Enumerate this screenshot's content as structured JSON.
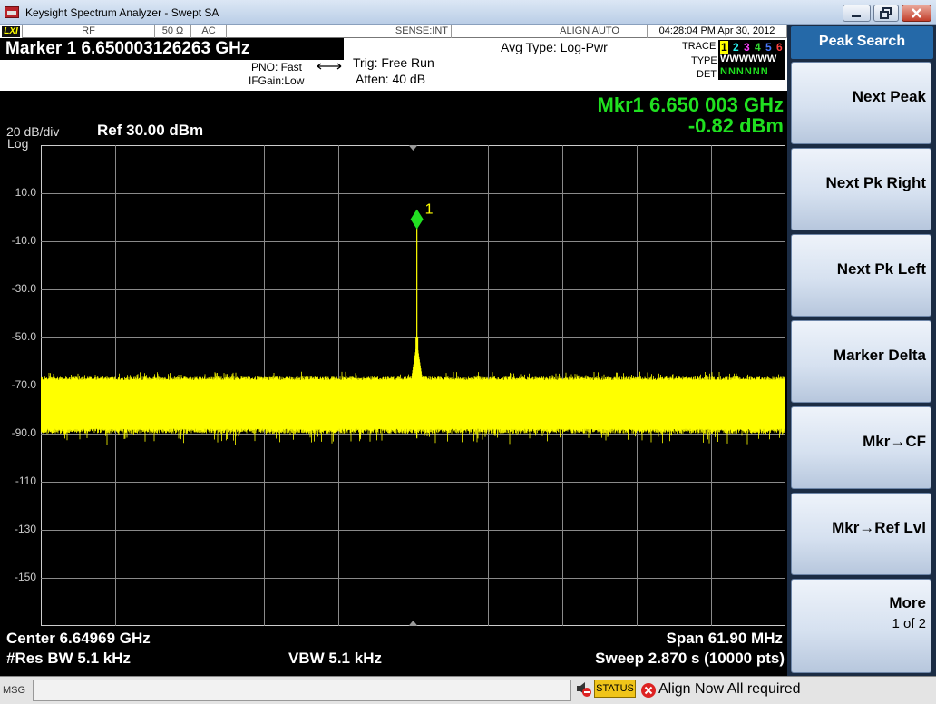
{
  "window": {
    "title": "Keysight Spectrum Analyzer - Swept SA"
  },
  "status_strip": {
    "lxi": "LXI",
    "rf": "RF",
    "impedance": "50 Ω",
    "coupling": "AC",
    "sense": "SENSE:INT",
    "align": "ALIGN AUTO",
    "datetime": "04:28:04 PM Apr 30, 2012"
  },
  "header": {
    "marker_readout": "Marker 1  6.650003126263 GHz",
    "pno": "PNO: Fast",
    "ifgain": "IFGain:Low",
    "trig": "Trig: Free Run",
    "atten": "Atten: 40 dB",
    "avg_type": "Avg Type: Log-Pwr",
    "trace_label": "TRACE",
    "type_label": "TYPE",
    "det_label": "DET",
    "trace_numbers": [
      "1",
      "2",
      "3",
      "4",
      "5",
      "6"
    ],
    "trace_colors": [
      "#ffff00",
      "#2af0f0",
      "#ff40ff",
      "#33e033",
      "#4a7bff",
      "#ff4040"
    ],
    "type_values": "WWWWWW",
    "det_values": "NNNNNN"
  },
  "screen": {
    "mkr_freq": "Mkr1 6.650 003 GHz",
    "mkr_amp": "-0.82 dBm",
    "scale": "20 dB/div",
    "ref": "Ref 30.00 dBm",
    "log": "Log",
    "y_labels": [
      "10.0",
      "-10.0",
      "-30.0",
      "-50.0",
      "-70.0",
      "-90.0",
      "-110",
      "-130",
      "-150"
    ],
    "marker_label": "1",
    "center": "Center 6.64969 GHz",
    "res_bw": "#Res BW 5.1 kHz",
    "vbw": "VBW 5.1 kHz",
    "span": "Span 61.90 MHz",
    "sweep": "Sweep  2.870 s (10000 pts)"
  },
  "chart_data": {
    "type": "line",
    "xlabel": "",
    "ylabel": "",
    "x_center_ghz": 6.64969,
    "span_mhz": 61.9,
    "ylim": [
      -170,
      30
    ],
    "y_unit": "dBm",
    "y_ticks": [
      10,
      -10,
      -30,
      -50,
      -70,
      -90,
      -110,
      -130,
      -150
    ],
    "noise_floor": {
      "top_dbm": -67,
      "bottom_dbm": -88
    },
    "peak": {
      "freq_ghz": 6.650003,
      "amp_dbm": -0.82
    },
    "trace_color": "#ffff00",
    "grid": true
  },
  "softkeys": {
    "title": "Peak Search",
    "keys": [
      {
        "label": "Next Peak"
      },
      {
        "label": "Next Pk Right"
      },
      {
        "label": "Next Pk Left"
      },
      {
        "label": "Marker Delta"
      },
      {
        "label": "Mkr→CF"
      },
      {
        "label": "Mkr→Ref Lvl"
      },
      {
        "label": "More",
        "sub": "1 of 2"
      }
    ]
  },
  "bottom": {
    "msg_label": "MSG",
    "status_button": "STATUS",
    "status_message": "Align Now All required"
  }
}
